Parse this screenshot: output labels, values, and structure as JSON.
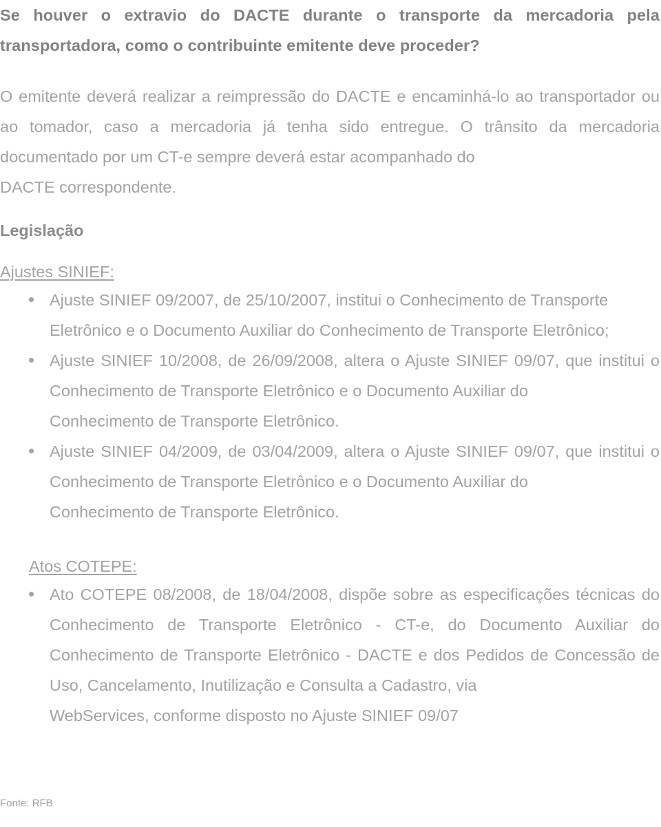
{
  "document": {
    "question": "Se houver o extravio do DACTE durante o transporte da mercadoria pela transportadora, como o contribuinte emitente deve proceder?",
    "answer": "O emitente deverá realizar a reimpressão do DACTE e encaminhá-lo ao transportador ou ao tomador, caso a mercadoria já tenha sido entregue. O trânsito da mercadoria documentado por um CT-e sempre deverá estar acompanhado do DACTE correspondente.",
    "answer_lastline": "DACTE correspondente.",
    "answer_body": "O emitente deverá realizar a reimpressão do DACTE e encaminhá-lo ao transportador ou ao tomador, caso a mercadoria já tenha sido entregue. O trânsito da mercadoria documentado por um CT-e sempre deverá estar acompanhado do",
    "legislation_title": "Legislação",
    "sections": [
      {
        "heading": "Ajustes SINIEF:",
        "indented": false,
        "items": [
          {
            "body": "Ajuste SINIEF 09/2007, de 25/10/2007, institui o Conhecimento de Transporte",
            "lastline": "Eletrônico e o Documento Auxiliar do Conhecimento de Transporte Eletrônico;"
          },
          {
            "body": "Ajuste SINIEF 10/2008, de 26/09/2008, altera o Ajuste SINIEF 09/07, que institui o Conhecimento de Transporte Eletrônico e o Documento Auxiliar do",
            "lastline": "Conhecimento de Transporte Eletrônico."
          },
          {
            "body": "Ajuste SINIEF 04/2009, de 03/04/2009, altera o Ajuste SINIEF 09/07, que institui o Conhecimento de Transporte Eletrônico e o Documento Auxiliar do",
            "lastline": "Conhecimento de Transporte Eletrônico."
          }
        ]
      },
      {
        "heading": "Atos COTEPE:",
        "indented": true,
        "items": [
          {
            "body": "Ato COTEPE 08/2008, de 18/04/2008, dispõe sobre as especificações técnicas do Conhecimento de Transporte Eletrônico - CT-e, do Documento Auxiliar do Conhecimento de Transporte Eletrônico - DACTE e dos Pedidos de Concessão de Uso, Cancelamento, Inutilização e Consulta a Cadastro, via",
            "lastline": "WebServices, conforme disposto no Ajuste SINIEF 09/07"
          }
        ]
      }
    ],
    "footer": "Fonte: RFB"
  },
  "colors": {
    "heading": "#828282",
    "body": "#a3a3a3",
    "background": "#ffffff",
    "footer": "#a0a0a0"
  }
}
